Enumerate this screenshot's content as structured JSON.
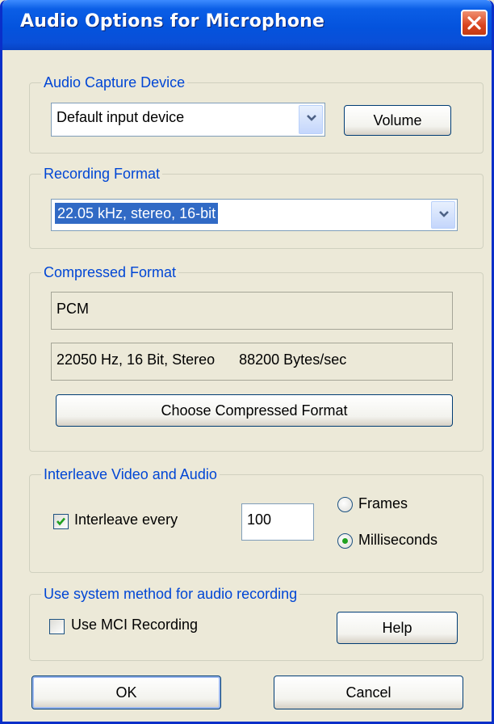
{
  "window": {
    "title": "Audio Options for Microphone",
    "close_icon": "close-icon"
  },
  "capture": {
    "label": "Audio Capture Device",
    "device": "Default input device",
    "volume_button": "Volume"
  },
  "recording": {
    "label": "Recording Format",
    "format": "22.05 kHz, stereo, 16-bit"
  },
  "compressed": {
    "label": "Compressed Format",
    "codec": "PCM",
    "details": "22050 Hz, 16 Bit, Stereo      88200 Bytes/sec",
    "choose_button": "Choose  Compressed Format"
  },
  "interleave": {
    "label": "Interleave Video and Audio",
    "checkbox_label": "Interleave every",
    "checked": true,
    "value": "100",
    "frames_label": "Frames",
    "ms_label": "Milliseconds",
    "selected": "Milliseconds"
  },
  "system": {
    "label": "Use system method for audio recording",
    "mci_label": "Use MCI Recording",
    "mci_checked": false,
    "help_button": "Help"
  },
  "footer": {
    "ok_button": "OK",
    "cancel_button": "Cancel"
  },
  "colors": {
    "title_bar": "#0453dd",
    "group_label": "#0046d5",
    "selection": "#316ac5",
    "dialog_bg": "#ece9d8"
  }
}
